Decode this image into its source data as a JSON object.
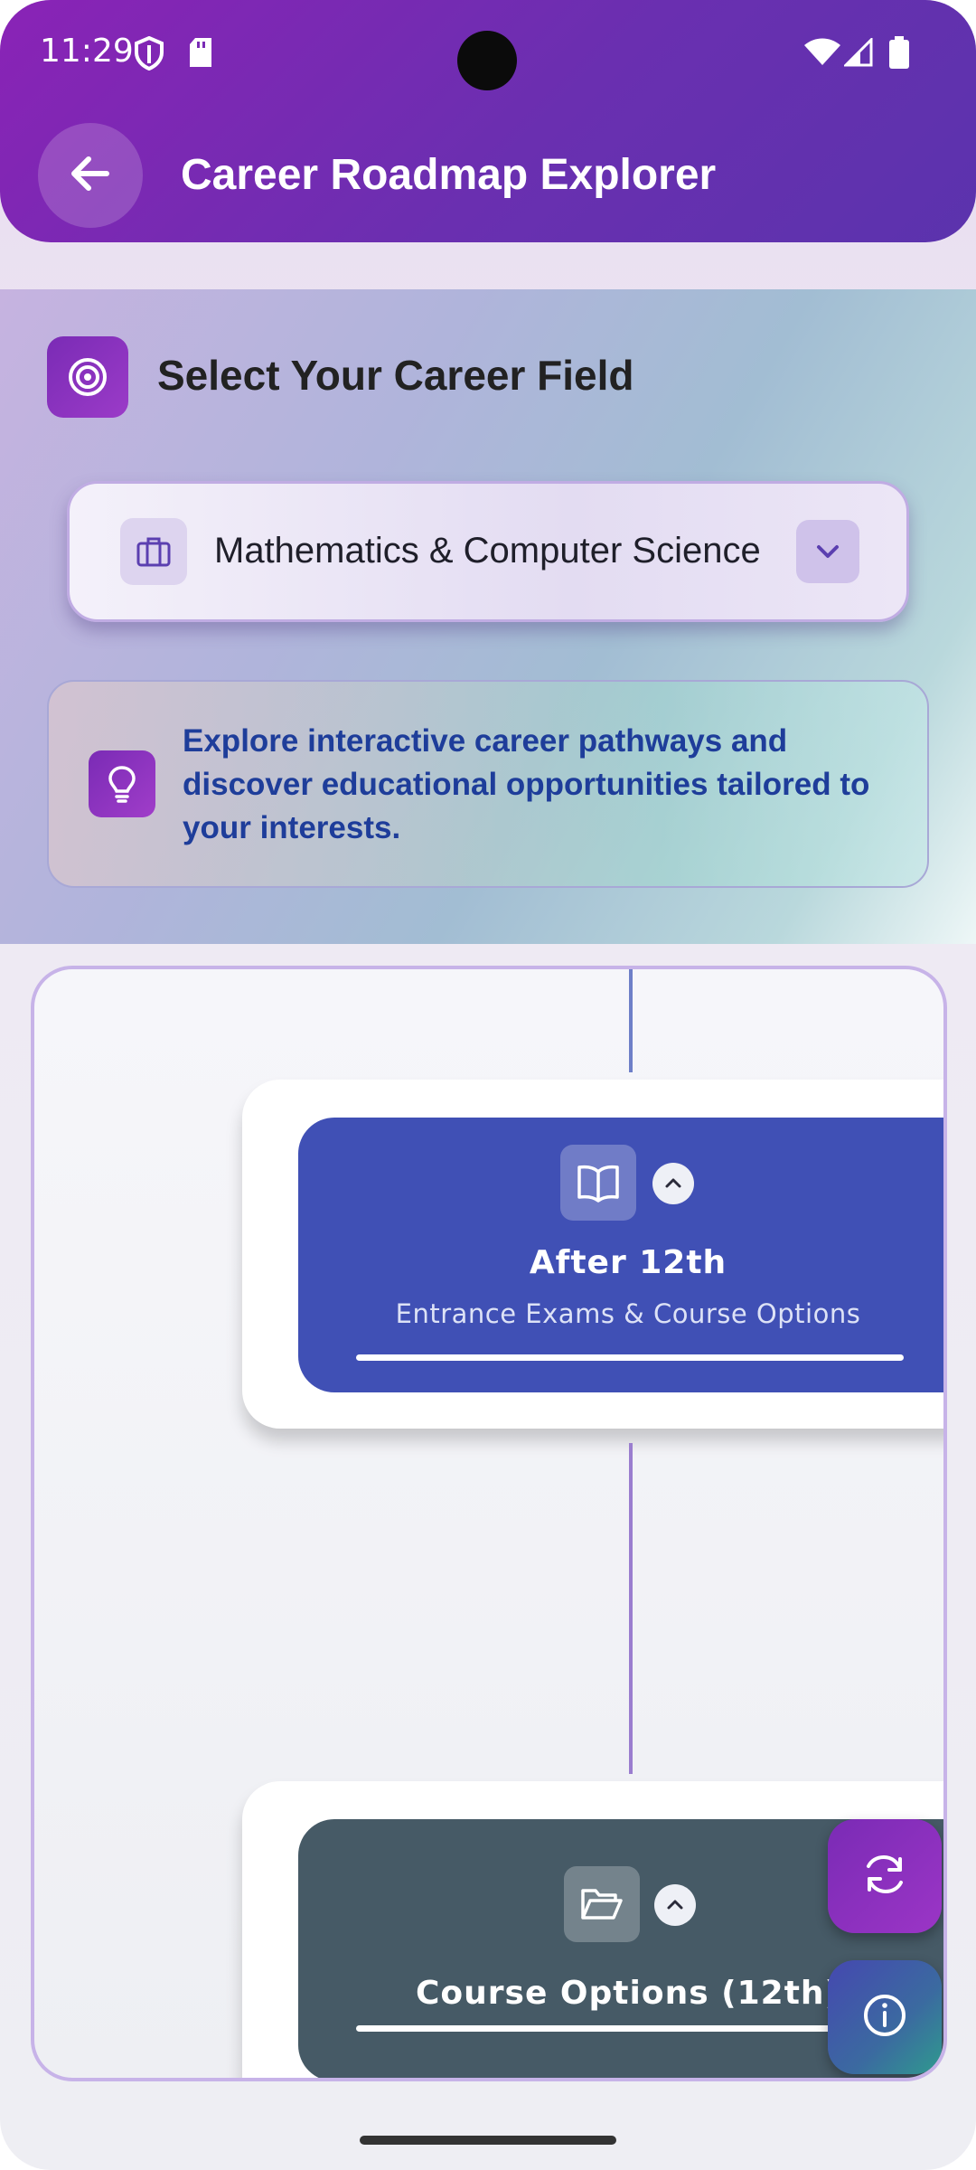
{
  "status_bar": {
    "time": "11:29"
  },
  "header": {
    "title": "Career Roadmap Explorer",
    "back_icon": "arrow-left-icon"
  },
  "selector": {
    "title": "Select Your Career Field",
    "dropdown_value": "Mathematics & Computer Science",
    "tip": "Explore interactive career pathways and discover educational opportunities tailored to your interests."
  },
  "roadmap": {
    "stages": [
      {
        "title": "After 12th",
        "subtitle": "Entrance Exams & Course Options",
        "icon": "book-open-icon",
        "color": "#4050b5"
      },
      {
        "title": "Course Options (12th)",
        "subtitle": "",
        "icon": "folder-open-icon",
        "color": "#465a66"
      }
    ]
  },
  "fabs": [
    {
      "icon": "refresh-icon",
      "color": "#8a2fba"
    },
    {
      "icon": "info-icon",
      "color": "#3a4fa0"
    }
  ],
  "colors": {
    "primary": "#7a2bb5",
    "accent_blue": "#4050b5",
    "slate": "#465a66"
  }
}
